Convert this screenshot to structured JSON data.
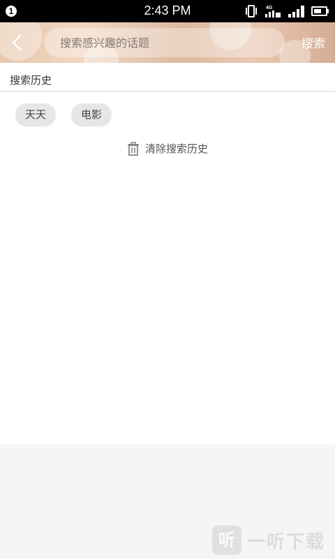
{
  "status_bar": {
    "notification_count": "1",
    "time": "2:43 PM",
    "network_type": "4G",
    "icons": [
      "vibrate-icon",
      "network-4g-icon",
      "signal-icon",
      "battery-icon"
    ]
  },
  "header": {
    "search_placeholder": "搜索感兴趣的话题",
    "search_button_label": "搜索",
    "back_icon": "chevron-left-icon"
  },
  "history": {
    "title": "搜索历史",
    "tags": [
      "天天",
      "电影"
    ],
    "clear_label": "清除搜索历史",
    "clear_icon": "trash-icon"
  },
  "watermark": {
    "logo_char": "听",
    "text": "一听下载"
  }
}
